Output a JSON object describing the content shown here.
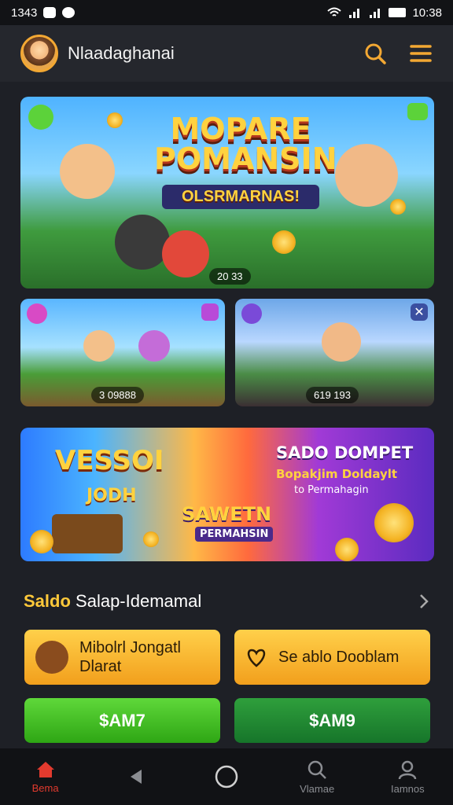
{
  "status": {
    "time": "1343",
    "clock": "10:38"
  },
  "header": {
    "app_title": "Nlaadaghanai"
  },
  "banner_main": {
    "line1": "MOPARE",
    "line2": "POMANSIN",
    "sub": "OLSRMARNAS!",
    "counter": "20 33"
  },
  "banner_left": {
    "counter": "3 09888"
  },
  "banner_right": {
    "counter": "619 193"
  },
  "banner_promo": {
    "left_big": "VESSOI",
    "left_sub": "JODH",
    "center_big": "SAWETN",
    "center_sub": "PERMAHSIN",
    "right_title": "SADO DOMPET",
    "right_sub": "Bopakjim Doldaylt",
    "right_sub2": "to Permahagin"
  },
  "section": {
    "label_bold": "Saldo",
    "label_rest": "Salap-Idemamal"
  },
  "buttons": {
    "card1_line1": "Mibolrl Jongatl",
    "card1_line2": "Dlarat",
    "card2_label": "Se ablo Dooblam",
    "pay1": "$AM7",
    "pay2": "$AM9"
  },
  "nav": {
    "home": "Bema",
    "search": "Vlamae",
    "profile": "Iamnos"
  },
  "colors": {
    "accent": "#f3a833",
    "active": "#e23a2e",
    "green": "#3bbf1f",
    "orange": "#f6b42f"
  }
}
